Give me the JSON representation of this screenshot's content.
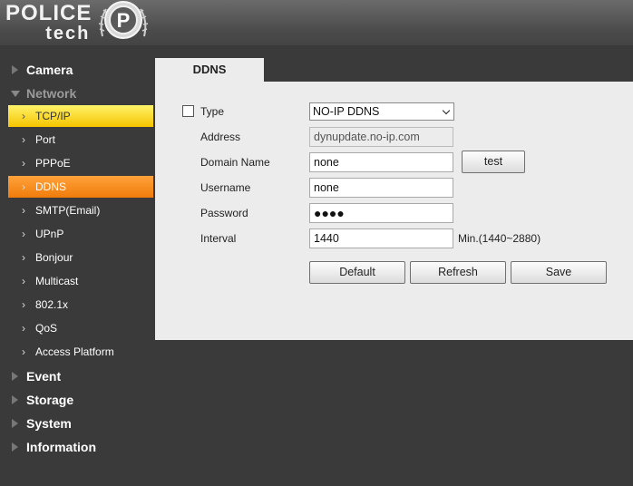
{
  "brand": {
    "line1": "POLICE",
    "line2": "tech"
  },
  "sidebar": {
    "categories": [
      {
        "label": "Camera"
      },
      {
        "label": "Network"
      },
      {
        "label": "Event"
      },
      {
        "label": "Storage"
      },
      {
        "label": "System"
      },
      {
        "label": "Information"
      }
    ],
    "network_items": [
      {
        "label": "TCP/IP"
      },
      {
        "label": "Port"
      },
      {
        "label": "PPPoE"
      },
      {
        "label": "DDNS"
      },
      {
        "label": "SMTP(Email)"
      },
      {
        "label": "UPnP"
      },
      {
        "label": "Bonjour"
      },
      {
        "label": "Multicast"
      },
      {
        "label": "802.1x"
      },
      {
        "label": "QoS"
      },
      {
        "label": "Access Platform"
      }
    ]
  },
  "tab": {
    "label": "DDNS"
  },
  "form": {
    "type": {
      "label": "Type",
      "value": "NO-IP DDNS",
      "enabled": false
    },
    "address": {
      "label": "Address",
      "value": "dynupdate.no-ip.com"
    },
    "domain": {
      "label": "Domain Name",
      "value": "none"
    },
    "username": {
      "label": "Username",
      "value": "none"
    },
    "password": {
      "label": "Password",
      "value": "●●●●"
    },
    "interval": {
      "label": "Interval",
      "value": "1440",
      "suffix": "Min.(1440~2880)"
    },
    "test_label": "test"
  },
  "buttons": {
    "default": "Default",
    "refresh": "Refresh",
    "save": "Save"
  }
}
